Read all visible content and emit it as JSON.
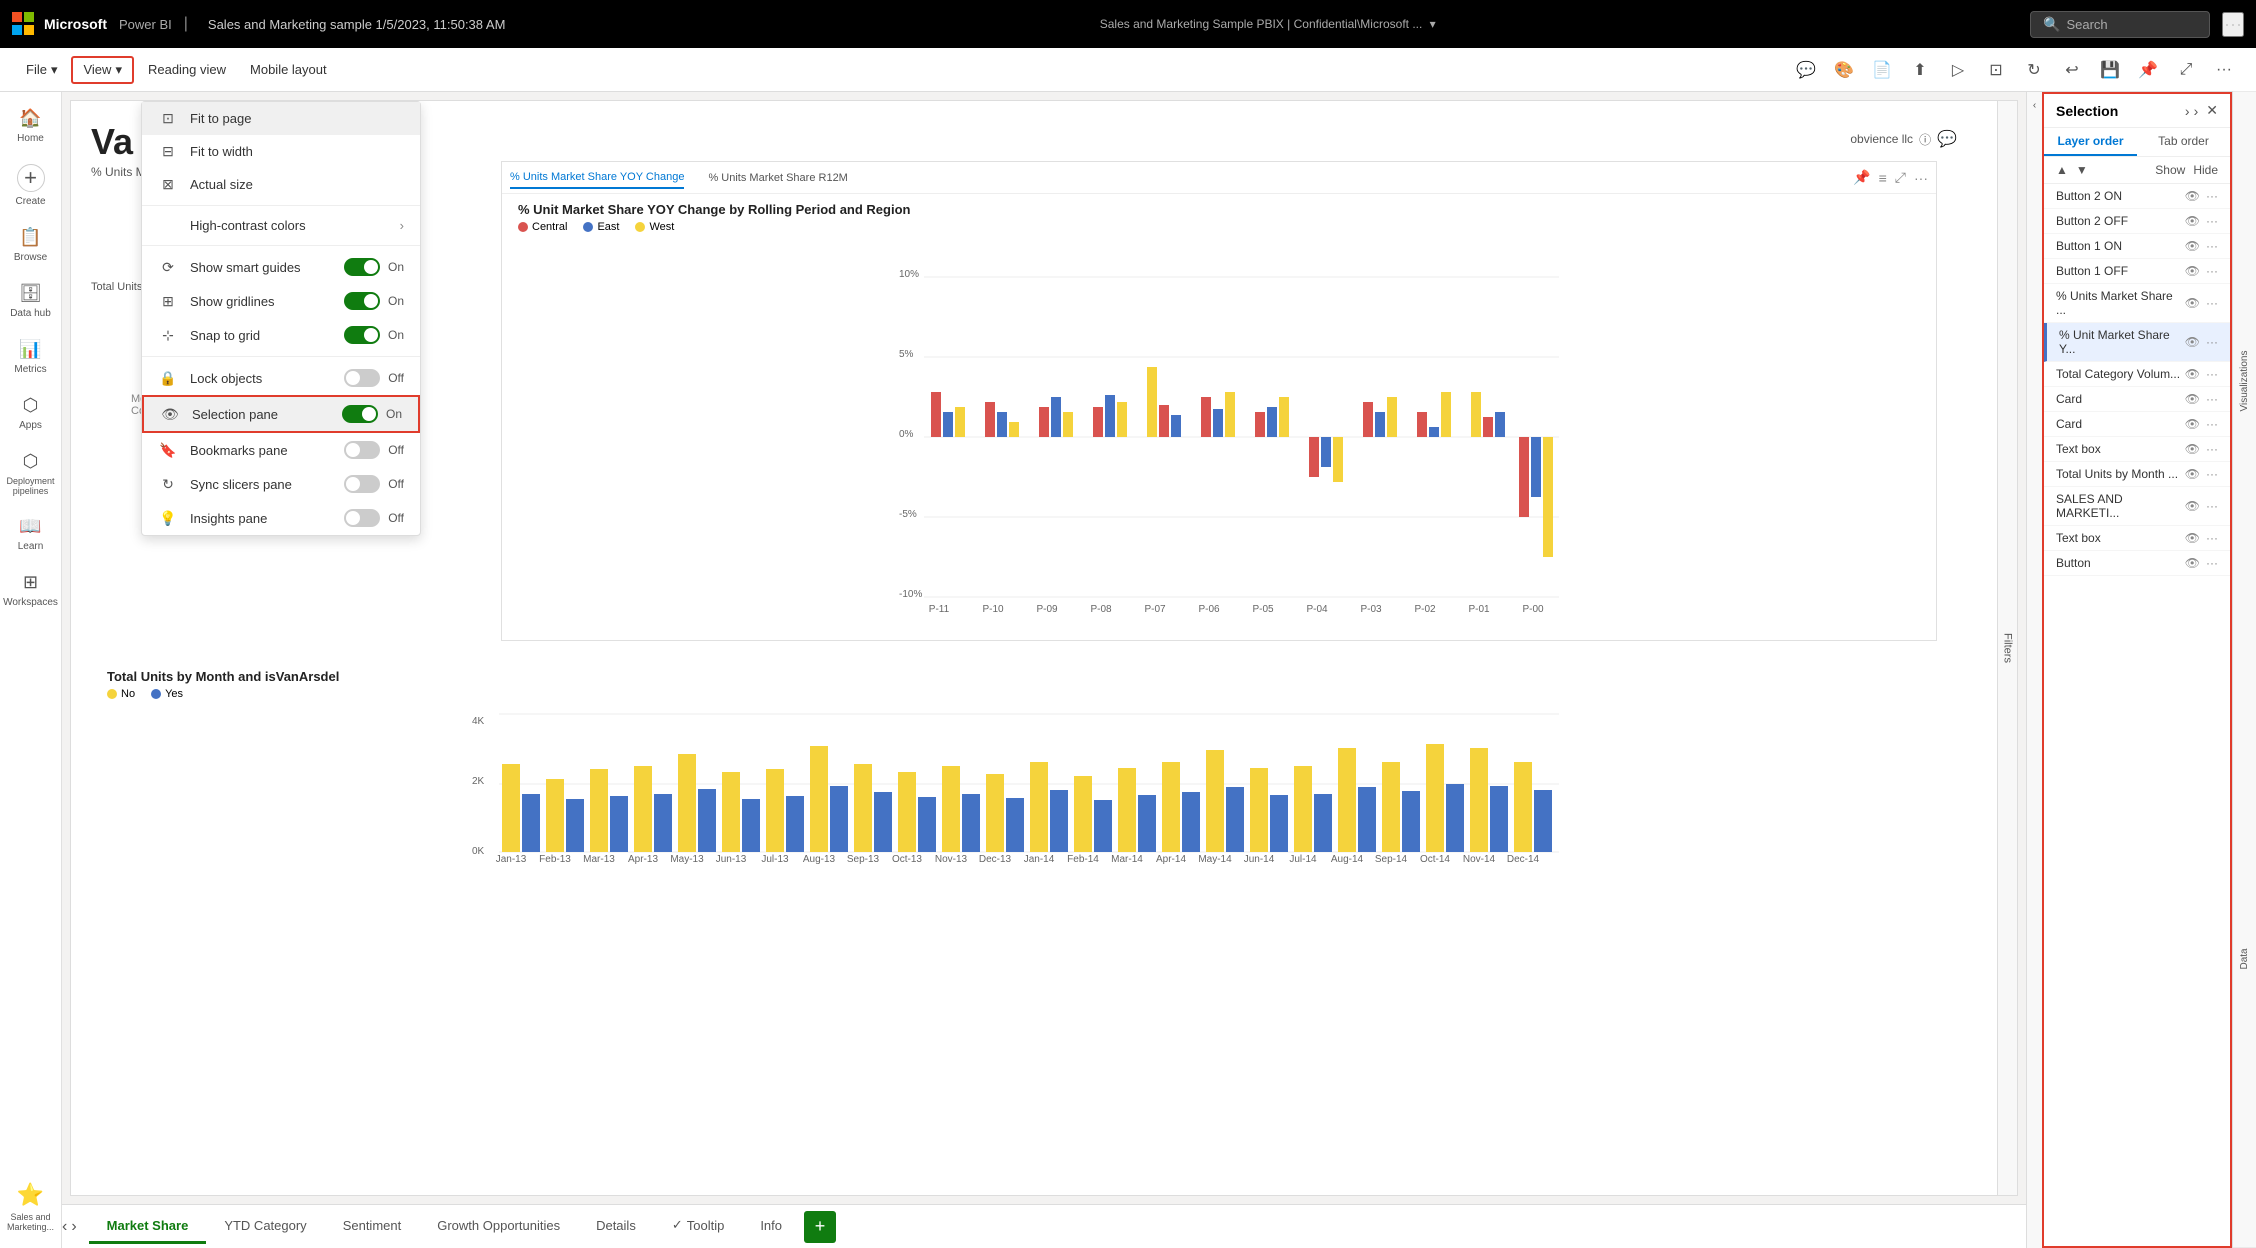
{
  "app": {
    "title": "Power BI",
    "report_title": "Sales and Marketing sample 1/5/2023, 11:50:38 AM",
    "workspace": "Sales and Marketing Sample PBIX | Confidential\\Microsoft ...",
    "search_placeholder": "Search"
  },
  "ribbon": {
    "file_label": "File",
    "view_label": "View",
    "reading_view_label": "Reading view",
    "mobile_layout_label": "Mobile layout"
  },
  "view_menu": {
    "fit_to_page": "Fit to page",
    "fit_to_width": "Fit to width",
    "actual_size": "Actual size",
    "high_contrast": "High-contrast colors",
    "show_smart_guides": "Show smart guides",
    "show_gridlines": "Show gridlines",
    "snap_to_grid": "Snap to grid",
    "lock_objects": "Lock objects",
    "selection_pane": "Selection pane",
    "bookmarks_pane": "Bookmarks pane",
    "sync_slicers_pane": "Sync slicers pane",
    "insights_pane": "Insights pane",
    "on_label": "On",
    "off_label": "Off"
  },
  "sidebar": {
    "items": [
      {
        "label": "Home",
        "icon": "🏠"
      },
      {
        "label": "Create",
        "icon": "+"
      },
      {
        "label": "Browse",
        "icon": "📋"
      },
      {
        "label": "Data hub",
        "icon": "🗄"
      },
      {
        "label": "Metrics",
        "icon": "📊"
      },
      {
        "label": "Apps",
        "icon": "⬡"
      },
      {
        "label": "Deployment\npipelines",
        "icon": "⬡"
      },
      {
        "label": "Learn",
        "icon": "📖"
      },
      {
        "label": "Workspaces",
        "icon": "⊞"
      },
      {
        "label": "Sales and\nMarketing...",
        "icon": "⭐"
      }
    ]
  },
  "selection_panel": {
    "title": "Selection",
    "tab_layer": "Layer order",
    "tab_tab": "Tab order",
    "show_label": "Show",
    "hide_label": "Hide",
    "items": [
      {
        "name": "Button 2 ON",
        "selected": false
      },
      {
        "name": "Button 2 OFF",
        "selected": false
      },
      {
        "name": "Button 1 ON",
        "selected": false
      },
      {
        "name": "Button 1 OFF",
        "selected": false
      },
      {
        "name": "% Units Market Share ...",
        "selected": false
      },
      {
        "name": "% Unit Market Share Y...",
        "selected": true
      },
      {
        "name": "Total Category Volum...",
        "selected": false
      },
      {
        "name": "Card",
        "selected": false
      },
      {
        "name": "Card",
        "selected": false
      },
      {
        "name": "Text box",
        "selected": false
      },
      {
        "name": "Total Units by Month ...",
        "selected": false
      },
      {
        "name": "SALES AND MARKETI...",
        "selected": false
      },
      {
        "name": "Text box",
        "selected": false
      },
      {
        "name": "Button",
        "selected": false
      }
    ]
  },
  "tabs": [
    {
      "label": "Market Share",
      "active": true
    },
    {
      "label": "YTD Category",
      "active": false
    },
    {
      "label": "Sentiment",
      "active": false
    },
    {
      "label": "Growth Opportunities",
      "active": false
    },
    {
      "label": "Details",
      "active": false
    },
    {
      "label": "Tooltip",
      "active": false
    },
    {
      "label": "Info",
      "active": false
    }
  ],
  "canvas": {
    "section_title": "Va",
    "section_subtitle": "% Units Market Share",
    "author": "obvience llc",
    "chart1_title": "% Units Market Share YOY Change",
    "chart1_tab1": "% Units Market Share YOY Change",
    "chart1_tab2": "% Units Market Share R12M",
    "chart1_subtitle": "% Unit Market Share YOY Change by Rolling Period and Region",
    "chart1_legend": [
      "Central",
      "East",
      "West"
    ],
    "chart2_title": "Total Units by Month and isVanArsdel",
    "chart2_legend": [
      "No",
      "Yes"
    ],
    "total_units_label": "Total Units by Month",
    "percent_units_label": "% Units Market Share",
    "x_labels_1": [
      "P-11",
      "P-10",
      "P-09",
      "P-08",
      "P-07",
      "P-06",
      "P-05",
      "P-04",
      "P-03",
      "P-02",
      "P-01",
      "P-00"
    ],
    "y_labels_1": [
      "10%",
      "5%",
      "0%",
      "-5%",
      "-10%"
    ],
    "x_labels_2": [
      "Jan-13",
      "Feb-13",
      "Mar-13",
      "Apr-13",
      "May-13",
      "Jun-13",
      "Jul-13",
      "Aug-13",
      "Sep-13",
      "Oct-13",
      "Nov-13",
      "Dec-13",
      "Jan-14",
      "Feb-14",
      "Mar-14",
      "Apr-14",
      "May-14",
      "Jun-14",
      "Jul-14",
      "Aug-14",
      "Sep-14",
      "Oct-14",
      "Nov-14",
      "Dec-14"
    ],
    "y_labels_2": [
      "4K",
      "2K",
      "0K"
    ]
  },
  "filters_label": "Filters",
  "visualizations_label": "Visualizations",
  "data_label": "Data"
}
